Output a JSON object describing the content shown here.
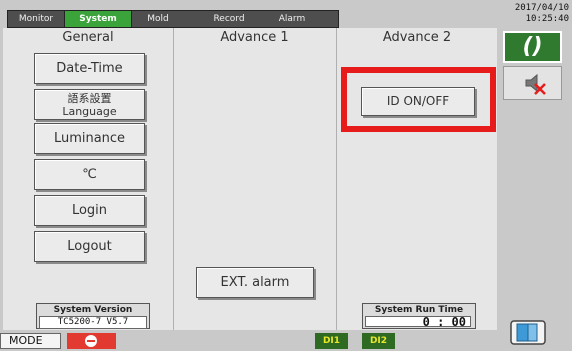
{
  "tabs": [
    "Monitor",
    "System",
    "Mold",
    "Record",
    "Alarm"
  ],
  "active_tab": "System",
  "datetime": {
    "date": "2017/04/10",
    "time": "10:25:40"
  },
  "columns": {
    "general": "General",
    "advance1": "Advance 1",
    "advance2": "Advance 2"
  },
  "general_buttons": {
    "datetime": "Date-Time",
    "language_cn": "語系設置",
    "language": "Language",
    "luminance": "Luminance",
    "temp_unit": "℃",
    "login": "Login",
    "logout": "Logout"
  },
  "advance1_buttons": {
    "ext_alarm": "EXT. alarm"
  },
  "advance2_buttons": {
    "id_onoff": "ID ON/OFF"
  },
  "system_version": {
    "label": "System Version",
    "value": "TC5200-7 V5.7"
  },
  "system_run_time": {
    "label": "System Run Time",
    "value": "0 : 00"
  },
  "status": {
    "mode": "MODE",
    "di1": "DI1",
    "di2": "DI2"
  },
  "colors": {
    "active_tab": "#3aa43a",
    "highlight": "#e81b1b",
    "lock_btn": "#2f7a2f",
    "stop": "#e23a30",
    "di_bg": "#2f6a22"
  }
}
